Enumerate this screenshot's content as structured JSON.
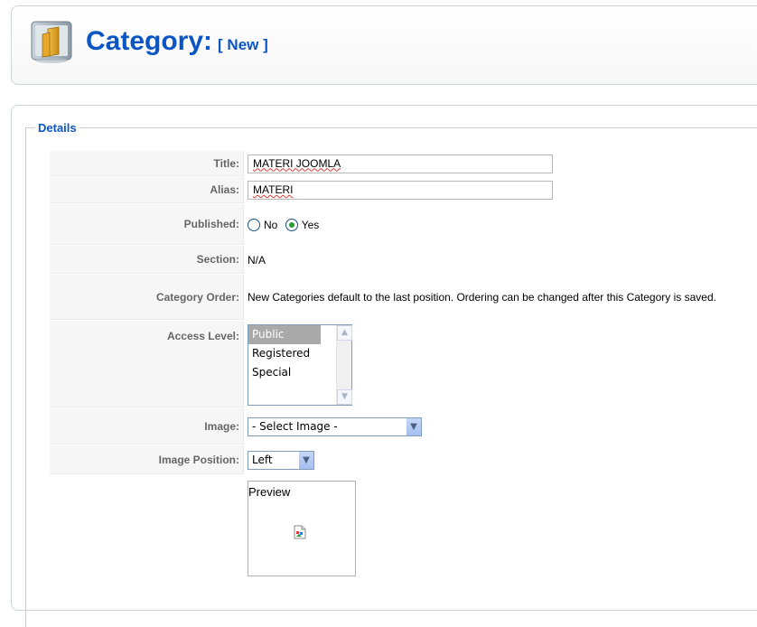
{
  "header": {
    "title": "Category:",
    "subtitle": "[ New ]"
  },
  "details": {
    "legend": "Details",
    "title_label": "Title:",
    "title_value": "MATERI JOOMLA",
    "alias_label": "Alias:",
    "alias_value": "MATERI",
    "published_label": "Published:",
    "published_no": "No",
    "published_yes": "Yes",
    "published_selected": "Yes",
    "section_label": "Section:",
    "section_value": "N/A",
    "order_label": "Category Order:",
    "order_text": "New Categories default to the last position. Ordering can be changed after this Category is saved.",
    "access_label": "Access Level:",
    "access_options": [
      "Public",
      "Registered",
      "Special"
    ],
    "access_selected": "Public",
    "image_label": "Image:",
    "image_value": "- Select Image -",
    "image_position_label": "Image Position:",
    "image_position_value": "Left",
    "preview_label": "Preview"
  },
  "icons": {
    "category": "category-folder-icon",
    "broken_image": "broken-image-icon"
  },
  "colors": {
    "accent": "#0b55c4",
    "radio_checked": "#2b9a33"
  }
}
